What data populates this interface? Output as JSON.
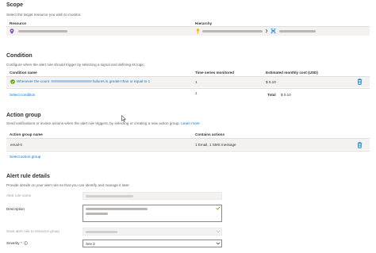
{
  "scope": {
    "heading": "Scope",
    "description": "Select the target resource you wish to monitor.",
    "columns": {
      "resource": "Resource",
      "hierarchy": "Hierarchy"
    }
  },
  "condition": {
    "heading": "Condition",
    "description": "Configure when the alert rule should trigger by selecting a signal and defining its logic.",
    "columns": {
      "name": "Condition name",
      "series": "Time series monitored",
      "cost": "Estimated monthly cost (USD)"
    },
    "rows": [
      {
        "name_prefix": "Whenever the count",
        "name_suffix": "failures is greater than or equal to 1",
        "series": "1",
        "cost": "$ 0.10"
      }
    ],
    "select_label": "Select condition",
    "footer_series": "1",
    "total_label": "Total",
    "total_value": "$ 0.10"
  },
  "action_group": {
    "heading": "Action group",
    "description": "Send notifications or invoke actions when the alert rule triggers, by selecting or creating a new action group.",
    "learn_more": "Learn more",
    "columns": {
      "name": "Action group name",
      "actions": "Contains actions"
    },
    "rows": [
      {
        "name": "email-it",
        "actions": "1 Email, 1 SMS message"
      }
    ],
    "select_label": "Select action group"
  },
  "details": {
    "heading": "Alert rule details",
    "description": "Provide details on your alert rule so that you can identify and manage it later.",
    "name_label": "Alert rule name",
    "description_label": "Description",
    "save_label": "Save alert rule to resource group",
    "severity_label": "Severity",
    "required_mark": "*",
    "severity_value": "Sev 2"
  },
  "colors": {
    "accent": "#0078d4",
    "divider": "#e1dfdd",
    "success": "#57a300"
  }
}
